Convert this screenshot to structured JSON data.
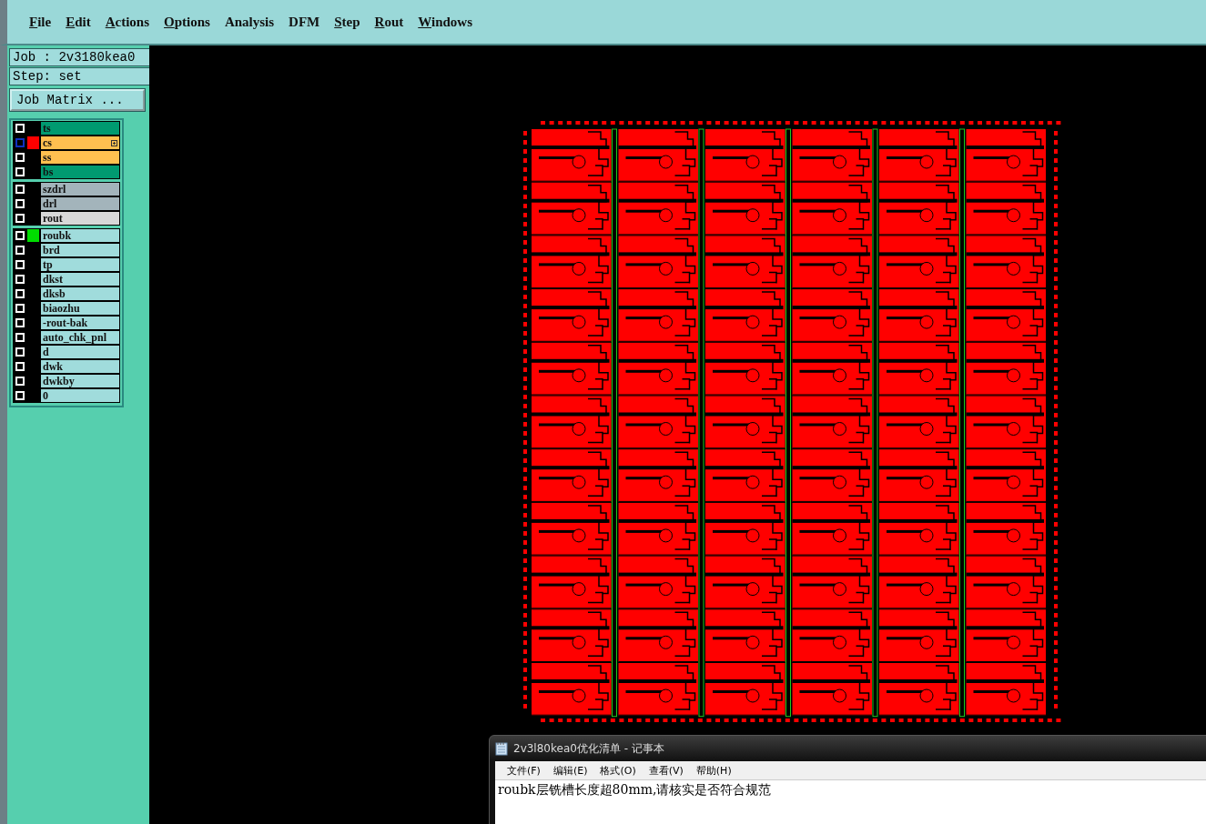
{
  "menu_bar": [
    {
      "label": "File",
      "underlined": true
    },
    {
      "label": "Edit",
      "underlined": true
    },
    {
      "label": "Actions",
      "underlined": true
    },
    {
      "label": "Options",
      "underlined": true
    },
    {
      "label": "Analysis",
      "underlined": false
    },
    {
      "label": "DFM",
      "underlined": false
    },
    {
      "label": "Step",
      "underlined": true
    },
    {
      "label": "Rout",
      "underlined": true
    },
    {
      "label": "Windows",
      "underlined": true
    }
  ],
  "job_panel": {
    "job": "Job : 2v3180kea0",
    "step": "Step: set",
    "matrix_button": "Job Matrix ..."
  },
  "layer_groups": [
    {
      "layers": [
        {
          "name": "ts",
          "kind": "mask",
          "work_layer": false,
          "checked": false
        },
        {
          "name": "cs",
          "kind": "signal",
          "work_layer": true,
          "checked": false,
          "color": "#ff0000"
        },
        {
          "name": "ss",
          "kind": "signal",
          "work_layer": false,
          "checked": false
        },
        {
          "name": "bs",
          "kind": "mask",
          "work_layer": false,
          "checked": false
        }
      ]
    },
    {
      "layers": [
        {
          "name": "szdrl",
          "kind": "drill",
          "work_layer": false,
          "checked": false
        },
        {
          "name": "drl",
          "kind": "drill",
          "work_layer": false,
          "checked": false
        },
        {
          "name": "rout",
          "kind": "rout",
          "work_layer": false,
          "checked": false
        }
      ]
    },
    {
      "layers": [
        {
          "name": "roubk",
          "kind": "document",
          "work_layer": false,
          "checked": false,
          "color": "#00dd00"
        },
        {
          "name": "brd",
          "kind": "document",
          "work_layer": false,
          "checked": false
        },
        {
          "name": "tp",
          "kind": "document",
          "work_layer": false,
          "checked": false
        },
        {
          "name": "dkst",
          "kind": "document",
          "work_layer": false,
          "checked": false
        },
        {
          "name": "dksb",
          "kind": "document",
          "work_layer": false,
          "checked": false
        },
        {
          "name": "biaozhu",
          "kind": "document",
          "work_layer": false,
          "checked": false
        },
        {
          "name": "-rout-bak",
          "kind": "document",
          "work_layer": false,
          "checked": false
        },
        {
          "name": "auto_chk_pnl",
          "kind": "document",
          "work_layer": false,
          "checked": false
        },
        {
          "name": "d",
          "kind": "document",
          "work_layer": false,
          "checked": false
        },
        {
          "name": "dwk",
          "kind": "document",
          "work_layer": false,
          "checked": false
        },
        {
          "name": "dwkby",
          "kind": "document",
          "work_layer": false,
          "checked": false
        },
        {
          "name": "0",
          "kind": "document",
          "work_layer": false,
          "checked": false
        }
      ]
    }
  ],
  "notepad": {
    "title": "2v3l80kea0优化清单 - 记事本",
    "menu": [
      "文件(F)",
      "编辑(E)",
      "格式(O)",
      "查看(V)",
      "帮助(H)"
    ],
    "content": "roubk层铣槽长度超80mm,请核实是否符合规范"
  }
}
